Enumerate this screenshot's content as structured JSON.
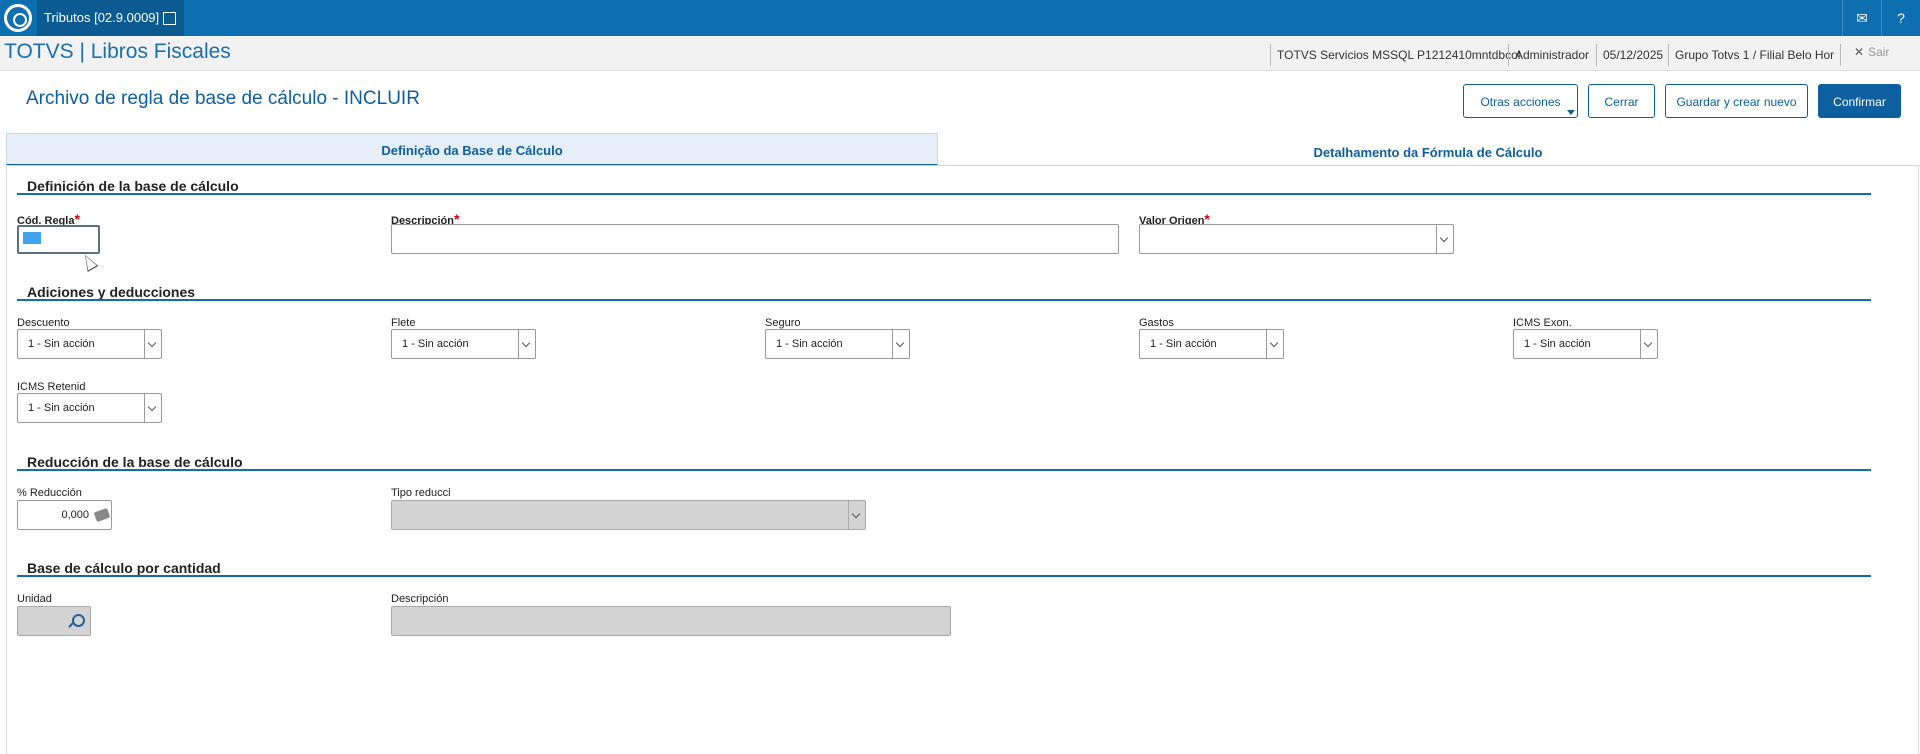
{
  "topbar": {
    "app_tab": "Tributos [02.9.0009]",
    "tab_close": "⊠",
    "mail_icon": "✉",
    "help_icon": "?"
  },
  "header": {
    "app_title": "TOTVS | Libros Fiscales",
    "environment": "TOTVS Servicios MSSQL P1212410mntdbcol",
    "user": "Administrador",
    "date": "05/12/2025",
    "branch": "Grupo Totvs 1 / Filial Belo Hor",
    "exit": "Sair"
  },
  "page": {
    "title": "Archivo de regla de base de cálculo - INCLUIR",
    "buttons": {
      "other_actions": "Otras acciones",
      "close": "Cerrar",
      "save_new": "Guardar y crear nuevo",
      "confirm": "Confirmar"
    },
    "tabs": [
      "Definição da Base de Cálculo",
      "Detalhamento da Fórmula de Cálculo"
    ]
  },
  "sections": {
    "definition": {
      "title": "Definición de la base de cálculo",
      "cod_label": "Cód. Regla",
      "desc_label": "Descripción",
      "valor_label": "Valor Origen",
      "required_mark": "*"
    },
    "additions": {
      "title": "Adiciones y deducciones",
      "fields": [
        {
          "label": "Descuento",
          "value": "1 - Sin acción"
        },
        {
          "label": "Flete",
          "value": "1 - Sin acción"
        },
        {
          "label": "Seguro",
          "value": "1 - Sin acción"
        },
        {
          "label": "Gastos",
          "value": "1 - Sin acción"
        },
        {
          "label": "ICMS Exon.",
          "value": "1 - Sin acción"
        },
        {
          "label": "ICMS Retenid",
          "value": "1 - Sin acción"
        }
      ]
    },
    "reduction": {
      "title": "Reducción de la base de cálculo",
      "percent_label": "% Reducción",
      "percent_value": "0,000",
      "type_label": "Tipo reducci"
    },
    "quantity": {
      "title": "Base de cálculo por cantidad",
      "unit_label": "Unidad",
      "desc_label": "Descripción"
    }
  }
}
